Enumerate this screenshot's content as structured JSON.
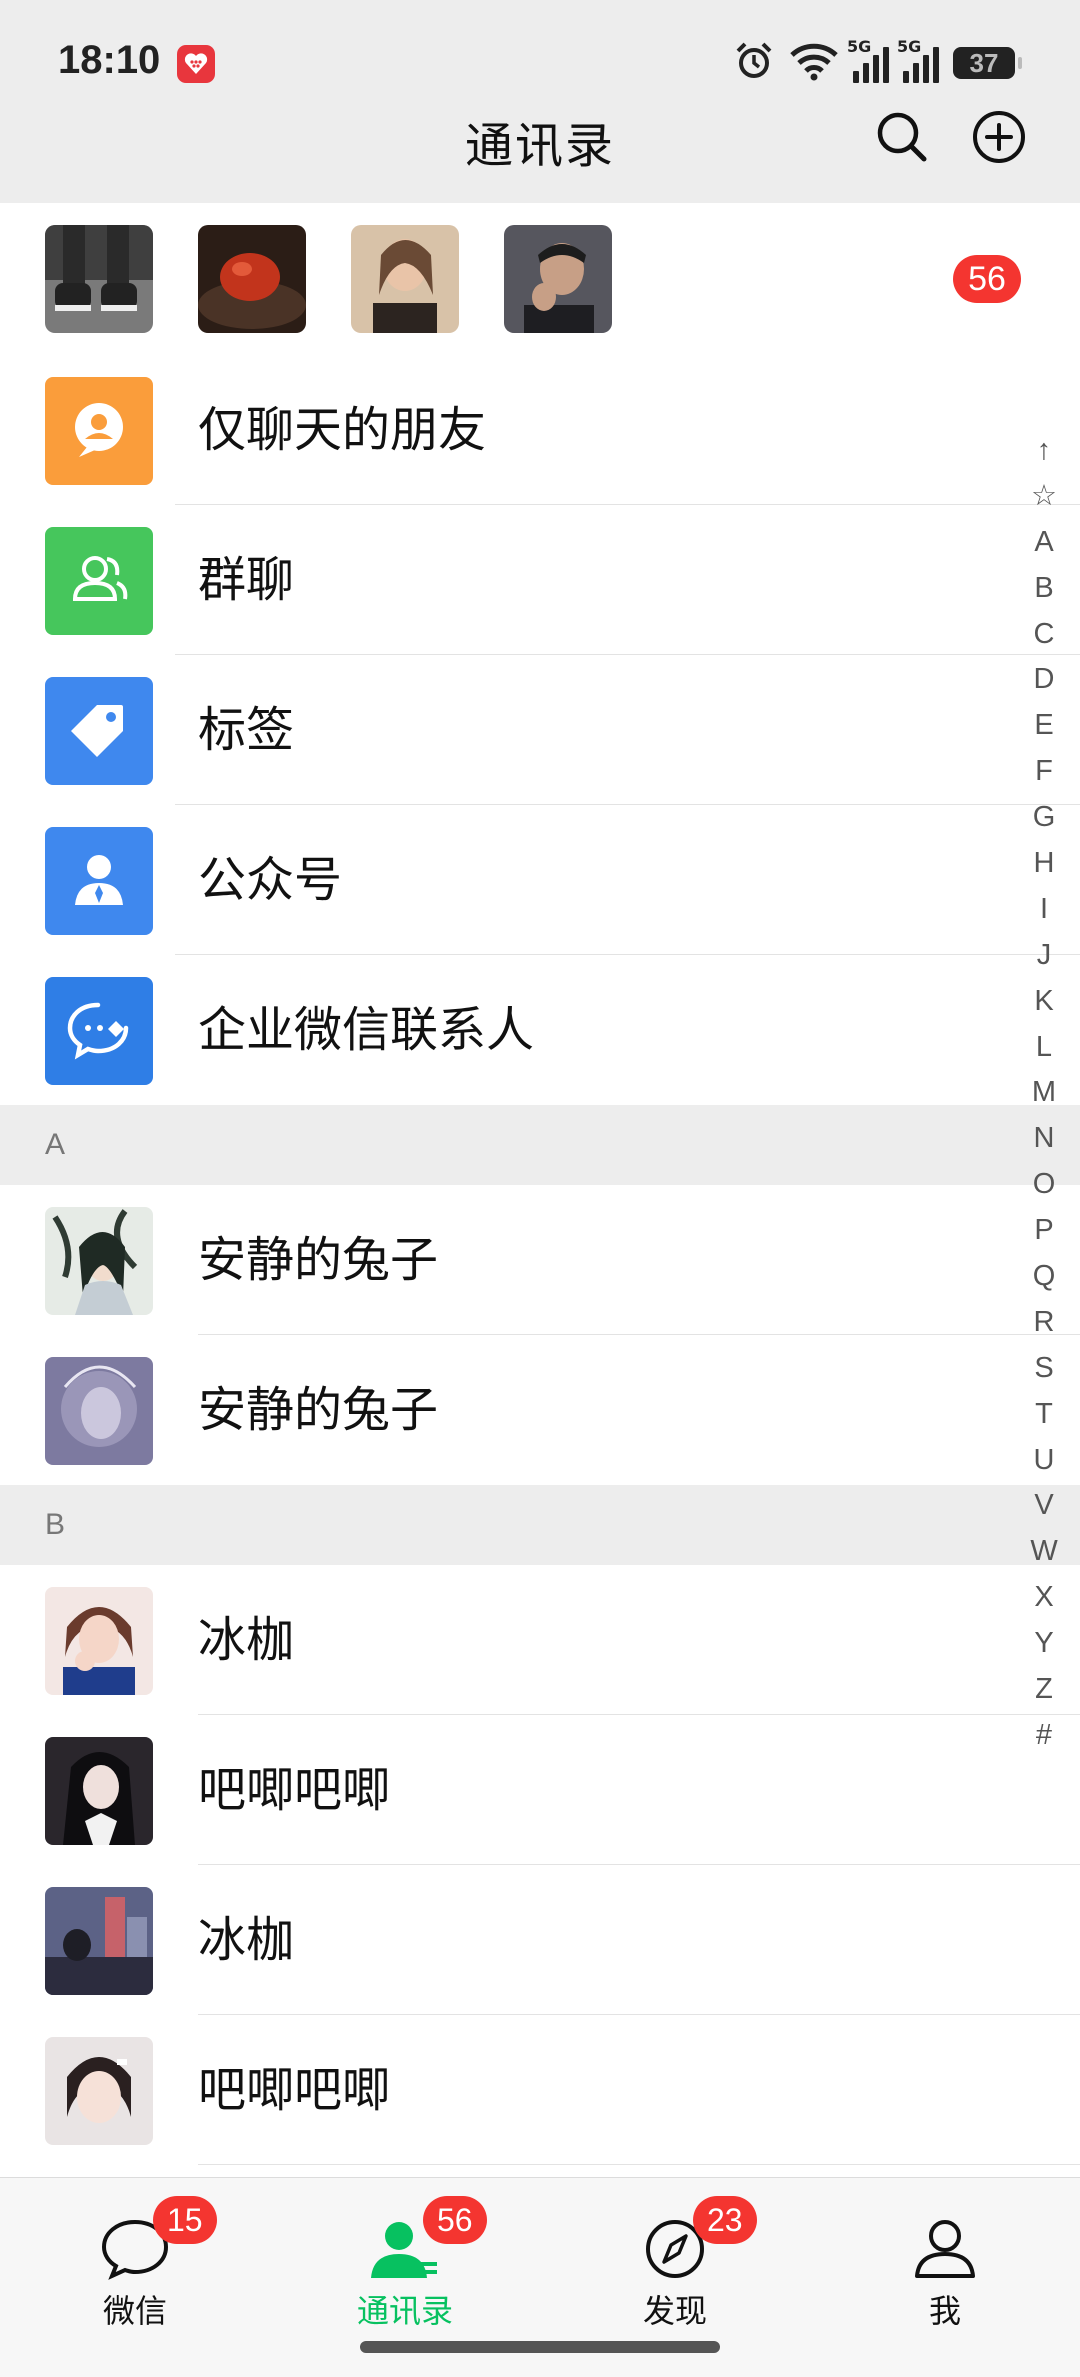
{
  "status_bar": {
    "time": "18:10",
    "network_1": "5G",
    "network_2": "5G",
    "battery": "37"
  },
  "header": {
    "title": "通讯录"
  },
  "recent_strip": {
    "badge": "56",
    "avatar_colors": [
      "#5b5b5b",
      "#3b2a20",
      "#c49a7a",
      "#4a4a52"
    ]
  },
  "function_rows": [
    {
      "label": "仅聊天的朋友",
      "color": "#fa9d3b"
    },
    {
      "label": "群聊",
      "color": "#46c65c"
    },
    {
      "label": "标签",
      "color": "#3f88ee"
    },
    {
      "label": "公众号",
      "color": "#3f88ee"
    },
    {
      "label": "企业微信联系人",
      "color": "#2f7ee6"
    }
  ],
  "sections": [
    {
      "letter": "A",
      "contacts": [
        {
          "name": "安静的兔子",
          "color": "#8f9c8e"
        },
        {
          "name": "安静的兔子",
          "color": "#8c88a6"
        }
      ]
    },
    {
      "letter": "B",
      "contacts": [
        {
          "name": "冰枷",
          "color": "#d49c8e"
        },
        {
          "name": "吧唧吧唧",
          "color": "#2d2a2f"
        },
        {
          "name": "冰枷",
          "color": "#5a5a78"
        },
        {
          "name": "吧唧吧唧",
          "color": "#c9b7b3"
        }
      ]
    }
  ],
  "index_bar": [
    "↑",
    "☆",
    "A",
    "B",
    "C",
    "D",
    "E",
    "F",
    "G",
    "H",
    "I",
    "J",
    "K",
    "L",
    "M",
    "N",
    "O",
    "P",
    "Q",
    "R",
    "S",
    "T",
    "U",
    "V",
    "W",
    "X",
    "Y",
    "Z",
    "#"
  ],
  "bottom_nav": [
    {
      "label": "微信",
      "badge": "15",
      "icon": "chat-bubble-icon"
    },
    {
      "label": "通讯录",
      "badge": "56",
      "icon": "contacts-icon",
      "active": true
    },
    {
      "label": "发现",
      "badge": "23",
      "icon": "compass-icon"
    },
    {
      "label": "我",
      "icon": "person-icon"
    }
  ],
  "colors": {
    "accent": "#07c160",
    "badge": "#f43530"
  }
}
